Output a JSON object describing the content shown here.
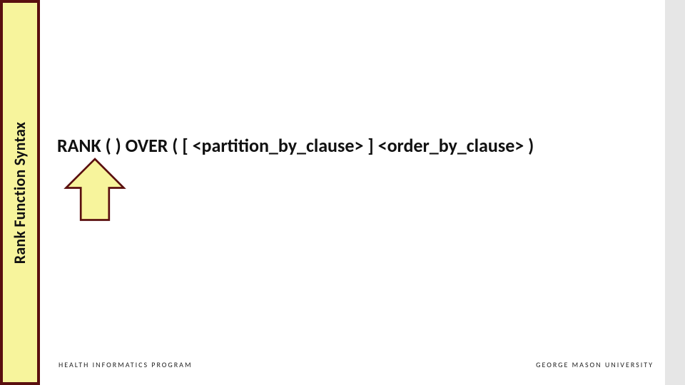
{
  "sidebar": {
    "title": "Rank Function Syntax"
  },
  "main": {
    "syntax": "RANK ( ) OVER ( [ <partition_by_clause> ] <order_by_clause> )"
  },
  "arrow": {
    "fill": "#f7f49c",
    "stroke": "#5a0f0f"
  },
  "footer": {
    "left": "HEALTH INFORMATICS PROGRAM",
    "right": "GEORGE MASON UNIVERSITY"
  }
}
